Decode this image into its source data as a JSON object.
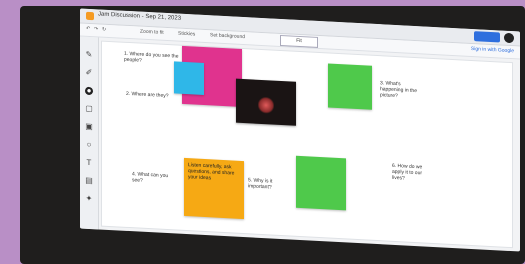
{
  "app": {
    "title": "Jam Discussion - Sep 21, 2023",
    "toolbar_items": [
      "↶",
      "↷",
      "↻",
      "Zoom to fit",
      "Stickies",
      "Set background"
    ],
    "zoom": "Fit",
    "right_label": "Sign in with Google"
  },
  "canvas": {
    "questions": [
      "1. Where do you see the people?",
      "2. Where are they?",
      "3. What's happening in the picture?",
      "4. What can you see?",
      "5. Why is it important?",
      "6. How do we apply it to our lives?"
    ],
    "notes": {
      "pink": "",
      "blue": "",
      "green_top": "",
      "orange": "Listen carefully, ask questions, and share your ideas",
      "green_bottom": ""
    }
  }
}
